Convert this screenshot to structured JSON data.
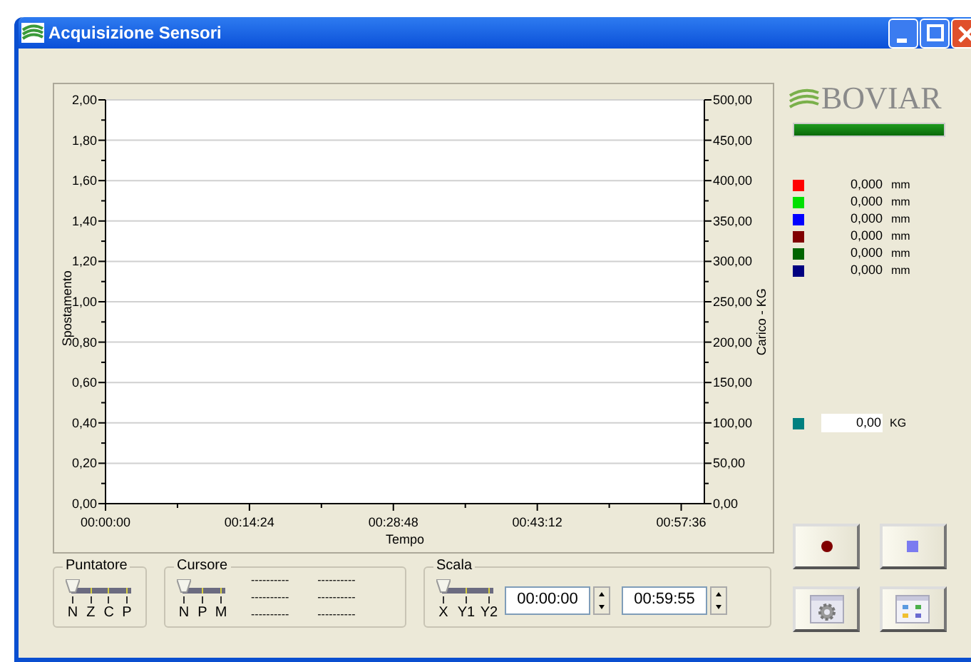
{
  "window": {
    "title": "Acquisizione Sensori",
    "controls": [
      {
        "kind": "minimize"
      },
      {
        "kind": "maximize"
      },
      {
        "kind": "close"
      }
    ]
  },
  "chart": {
    "chart_data": {
      "type": "line",
      "grid": true,
      "xlabel": "Tempo",
      "ylabel": "Spostamento",
      "xlim": [
        0,
        3595
      ],
      "ylim": [
        0,
        2
      ],
      "xticks": [
        {
          "value": 0,
          "label": "00:00:00"
        },
        {
          "value": 864,
          "label": "00:14:24"
        },
        {
          "value": 1728,
          "label": "00:28:48"
        },
        {
          "value": 2592,
          "label": "00:43:12"
        },
        {
          "value": 3456,
          "label": "00:57:36"
        }
      ],
      "yticks": [
        {
          "value": 0,
          "label": "0,00"
        },
        {
          "value": 0.2,
          "label": "0,20"
        },
        {
          "value": 0.4,
          "label": "0,40"
        },
        {
          "value": 0.6,
          "label": "0,60"
        },
        {
          "value": 0.8,
          "label": "0,80"
        },
        {
          "value": 1,
          "label": "1,00"
        },
        {
          "value": 1.2,
          "label": "1,20"
        },
        {
          "value": 1.4,
          "label": "1,40"
        },
        {
          "value": 1.6,
          "label": "1,60"
        },
        {
          "value": 1.8,
          "label": "1,80"
        },
        {
          "value": 2,
          "label": "2,00"
        }
      ]
    },
    "right_axis": {
      "label": "Carico - KG",
      "ticks": [
        "500,00",
        "450,00",
        "400,00",
        "350,00",
        "300,00",
        "250,00",
        "200,00",
        "150,00",
        "100,00",
        "50,00",
        "0,00"
      ]
    }
  },
  "puntatore": {
    "title": "Puntatore",
    "positions": [
      {
        "label": "N",
        "selected": true
      },
      {
        "label": "Z",
        "selected": false
      },
      {
        "label": "C",
        "selected": false
      },
      {
        "label": "P",
        "selected": false
      }
    ]
  },
  "cursore": {
    "title": "Cursore",
    "positions": [
      {
        "label": "N",
        "selected": true
      },
      {
        "label": "P",
        "selected": false
      },
      {
        "label": "M",
        "selected": false
      }
    ],
    "readouts": [
      [
        "----------",
        "----------"
      ],
      [
        "----------",
        "----------"
      ],
      [
        "----------",
        "----------"
      ]
    ]
  },
  "scala": {
    "title": "Scala",
    "positions": [
      {
        "label": "X",
        "selected": true
      },
      {
        "label": "Y1",
        "selected": false
      },
      {
        "label": "Y2",
        "selected": false
      }
    ],
    "start": "00:00:00",
    "end": "00:59:55"
  },
  "logo": {
    "text": "BOVIAR"
  },
  "status_bar": {
    "level": 1
  },
  "sensors": [
    {
      "color": "#ff0000",
      "value": "0,000",
      "unit": "mm"
    },
    {
      "color": "#00e000",
      "value": "0,000",
      "unit": "mm"
    },
    {
      "color": "#0000ff",
      "value": "0,000",
      "unit": "mm"
    },
    {
      "color": "#800000",
      "value": "0,000",
      "unit": "mm"
    },
    {
      "color": "#006400",
      "value": "0,000",
      "unit": "mm"
    },
    {
      "color": "#000080",
      "value": "0,000",
      "unit": "mm"
    }
  ],
  "load": {
    "color": "#008080",
    "value": "0,00",
    "unit": "KG"
  },
  "buttons": [
    {
      "kind": "record"
    },
    {
      "kind": "stop"
    },
    {
      "kind": "settings"
    },
    {
      "kind": "view"
    }
  ]
}
